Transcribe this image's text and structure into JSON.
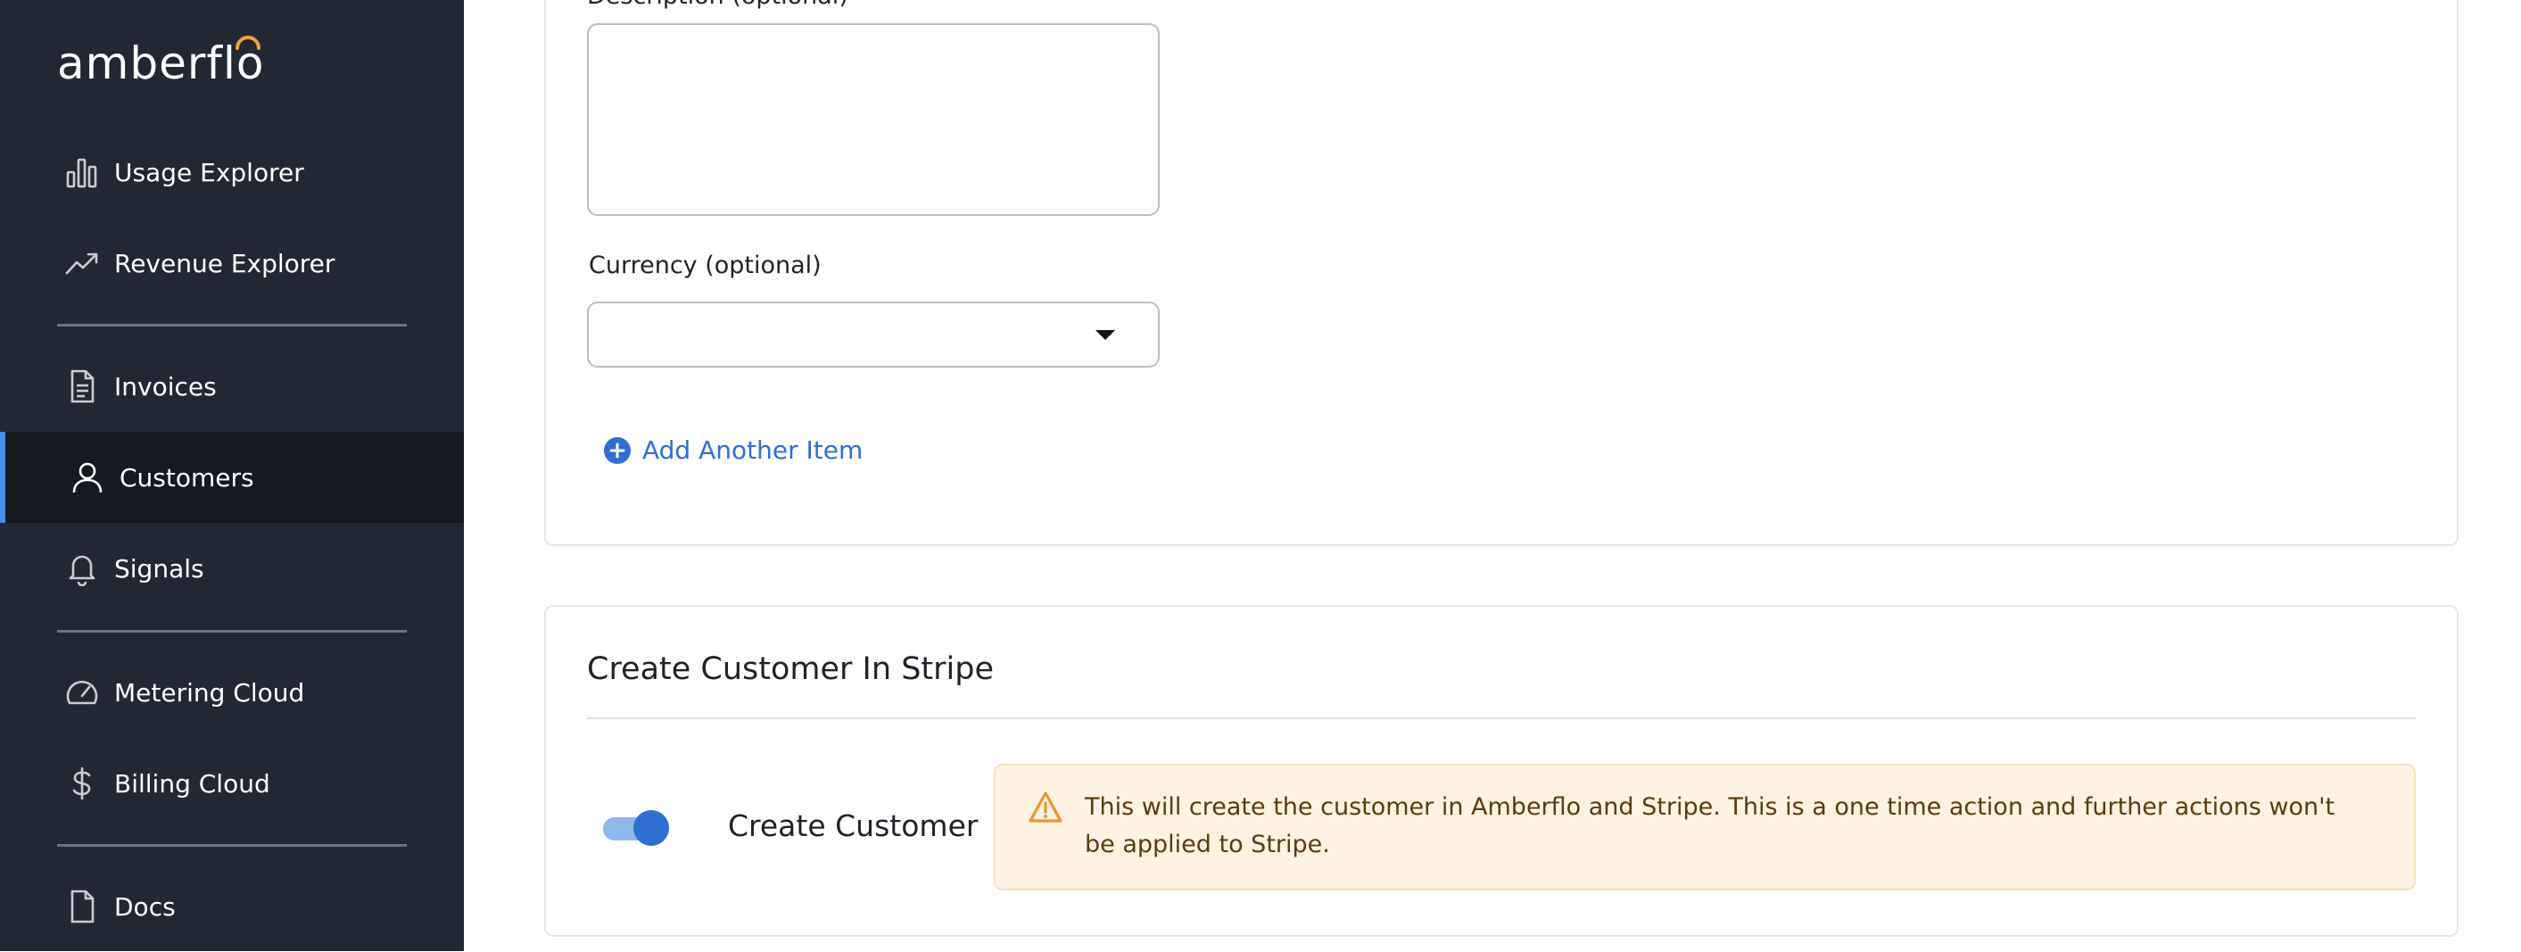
{
  "sidebar": {
    "logo_text": "amberflo",
    "items": [
      {
        "label": "Usage Explorer",
        "icon": "bar-chart-icon"
      },
      {
        "label": "Revenue Explorer",
        "icon": "trend-up-icon"
      },
      {
        "label": "Invoices",
        "icon": "document-icon"
      },
      {
        "label": "Customers",
        "icon": "user-icon",
        "active": true
      },
      {
        "label": "Signals",
        "icon": "bell-icon"
      },
      {
        "label": "Metering Cloud",
        "icon": "gauge-icon"
      },
      {
        "label": "Billing Cloud",
        "icon": "dollar-icon"
      },
      {
        "label": "Docs",
        "icon": "file-icon"
      }
    ]
  },
  "form": {
    "description_label": "Description (optional)",
    "description_value": "",
    "currency_label": "Currency (optional)",
    "currency_value": "",
    "add_item_label": "Add Another Item"
  },
  "stripe": {
    "title": "Create Customer In Stripe",
    "toggle_label": "Create Customer",
    "toggle_on": true,
    "warning": "This will create the customer in Amberflo and Stripe. This is a one time action and further actions won't be applied to Stripe."
  },
  "colors": {
    "sidebar_bg": "#222833",
    "active_accent": "#4a8de8",
    "link": "#2f6fd1",
    "warning_bg": "#fdf2e3",
    "warning_icon": "#e8962e"
  }
}
